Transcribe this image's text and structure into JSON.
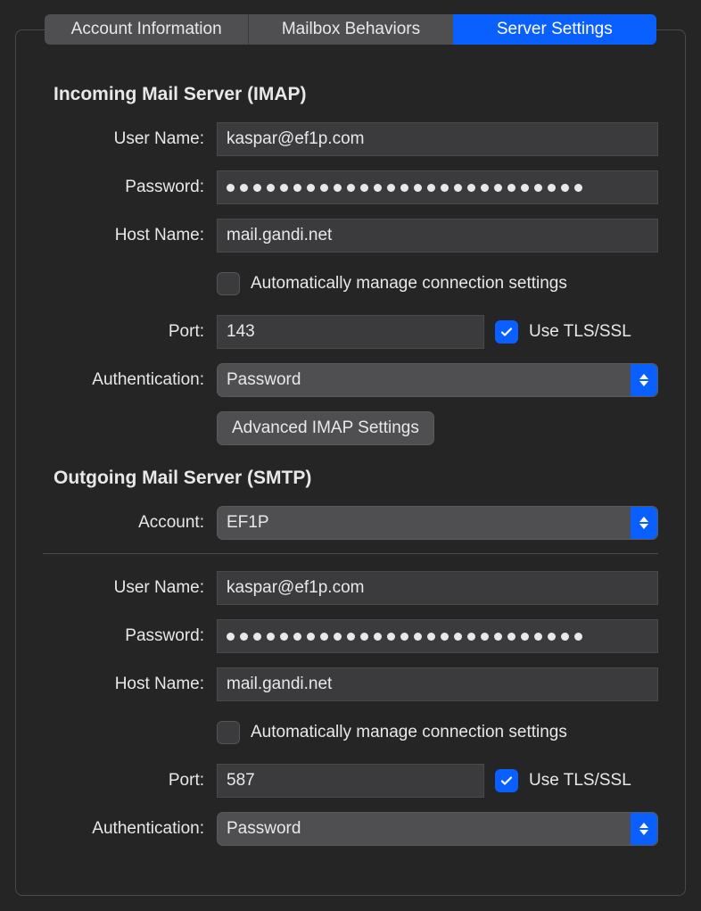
{
  "tabs": {
    "account_info": "Account Information",
    "mailbox_behaviors": "Mailbox Behaviors",
    "server_settings": "Server Settings"
  },
  "incoming": {
    "heading": "Incoming Mail Server (IMAP)",
    "labels": {
      "username": "User Name:",
      "password": "Password:",
      "hostname": "Host Name:",
      "port": "Port:",
      "authentication": "Authentication:"
    },
    "username": "kaspar@ef1p.com",
    "hostname": "mail.gandi.net",
    "port": "143",
    "auto_manage_label": "Automatically manage connection settings",
    "use_tls_label": "Use TLS/SSL",
    "authentication": "Password",
    "advanced_btn": "Advanced IMAP Settings"
  },
  "outgoing": {
    "heading": "Outgoing Mail Server (SMTP)",
    "labels": {
      "account": "Account:",
      "username": "User Name:",
      "password": "Password:",
      "hostname": "Host Name:",
      "port": "Port:",
      "authentication": "Authentication:"
    },
    "account": "EF1P",
    "username": "kaspar@ef1p.com",
    "hostname": "mail.gandi.net",
    "port": "587",
    "auto_manage_label": "Automatically manage connection settings",
    "use_tls_label": "Use TLS/SSL",
    "authentication": "Password"
  }
}
